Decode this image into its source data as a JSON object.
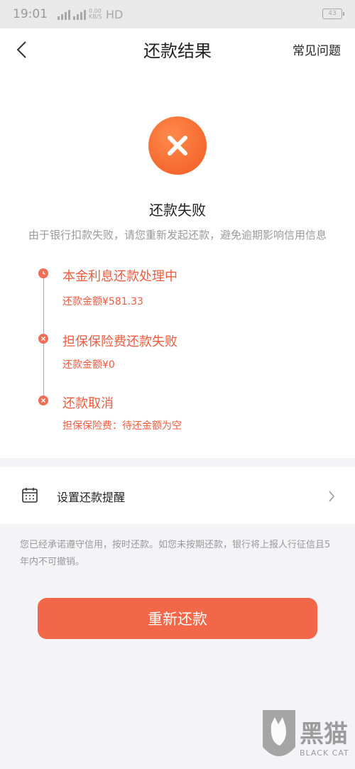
{
  "status_bar": {
    "time": "19:01",
    "net_speed": "0.00 KB/S",
    "network": "HD",
    "battery": "43"
  },
  "nav": {
    "title": "还款结果",
    "faq": "常见问题",
    "back_icon": "chevron-left-icon"
  },
  "result": {
    "icon": "close-icon",
    "title": "还款失败",
    "description": "由于银行扣款失败，请您重新发起还款，避免逾期影响信用信息"
  },
  "timeline": {
    "steps": [
      {
        "status": "processing",
        "icon": "clock-icon",
        "title": "本金利息还款处理中",
        "detail": "还款金额¥581.33"
      },
      {
        "status": "failed",
        "icon": "close-icon",
        "title": "担保保险费还款失败",
        "detail": "还款金额¥0"
      },
      {
        "status": "cancelled",
        "icon": "close-icon",
        "title": "还款取消",
        "detail": "担保保险费：待还金额为空"
      }
    ]
  },
  "reminder": {
    "icon": "calendar-icon",
    "label": "设置还款提醒"
  },
  "notice": "您已经承诺遵守信用，按时还款。如您未按期还款，银行将上报人行征信且5年内不可撤销。",
  "retry_button": "重新还款",
  "watermark": {
    "title": "黑猫",
    "subtitle": "BLACK CAT"
  },
  "colors": {
    "accent": "#f26748",
    "error_red": "#ef5b3f",
    "muted": "#9a9a9a"
  }
}
